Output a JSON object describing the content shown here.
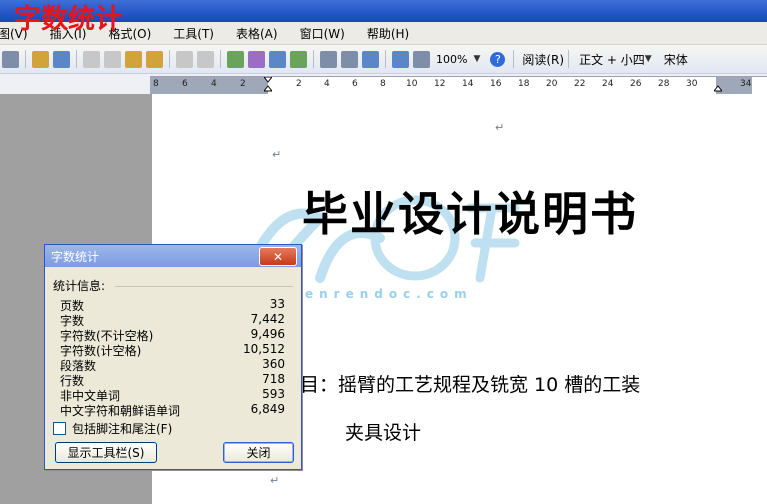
{
  "overlay_title": "字数统计",
  "menu": [
    "图(V)",
    "插入(I)",
    "格式(O)",
    "工具(T)",
    "表格(A)",
    "窗口(W)",
    "帮助(H)"
  ],
  "toolbar": {
    "zoom": "100%",
    "read_label": "阅读(R)",
    "style": "正文 + 小四",
    "font": "宋体"
  },
  "ruler_ticks": [
    "8",
    "6",
    "4",
    "2",
    "2",
    "4",
    "6",
    "8",
    "10",
    "12",
    "14",
    "16",
    "18",
    "20",
    "22",
    "24",
    "26",
    "28",
    "30",
    "34"
  ],
  "document": {
    "title": "毕业设计说明书",
    "topic_line1": "目：摇臂的工艺规程及铣宽 10 槽的工装",
    "topic_line2": "夹具设计"
  },
  "watermark": {
    "text": "www.renrendoc.com"
  },
  "dialog": {
    "title": "字数统计",
    "section_label": "统计信息:",
    "stats": [
      {
        "label": "页数",
        "value": "33"
      },
      {
        "label": "字数",
        "value": "7,442"
      },
      {
        "label": "字符数(不计空格)",
        "value": "9,496"
      },
      {
        "label": "字符数(计空格)",
        "value": "10,512"
      },
      {
        "label": "段落数",
        "value": "360"
      },
      {
        "label": "行数",
        "value": "718"
      },
      {
        "label": "非中文单词",
        "value": "593"
      },
      {
        "label": "中文字符和朝鲜语单词",
        "value": "6,849"
      }
    ],
    "checkbox_label": "包括脚注和尾注(F)",
    "show_toolbar_button": "显示工具栏(S)",
    "close_button": "关闭"
  },
  "icons": [
    "close-icon",
    "help-icon",
    "undo-icon",
    "redo-icon",
    "table-icon",
    "read-icon"
  ]
}
